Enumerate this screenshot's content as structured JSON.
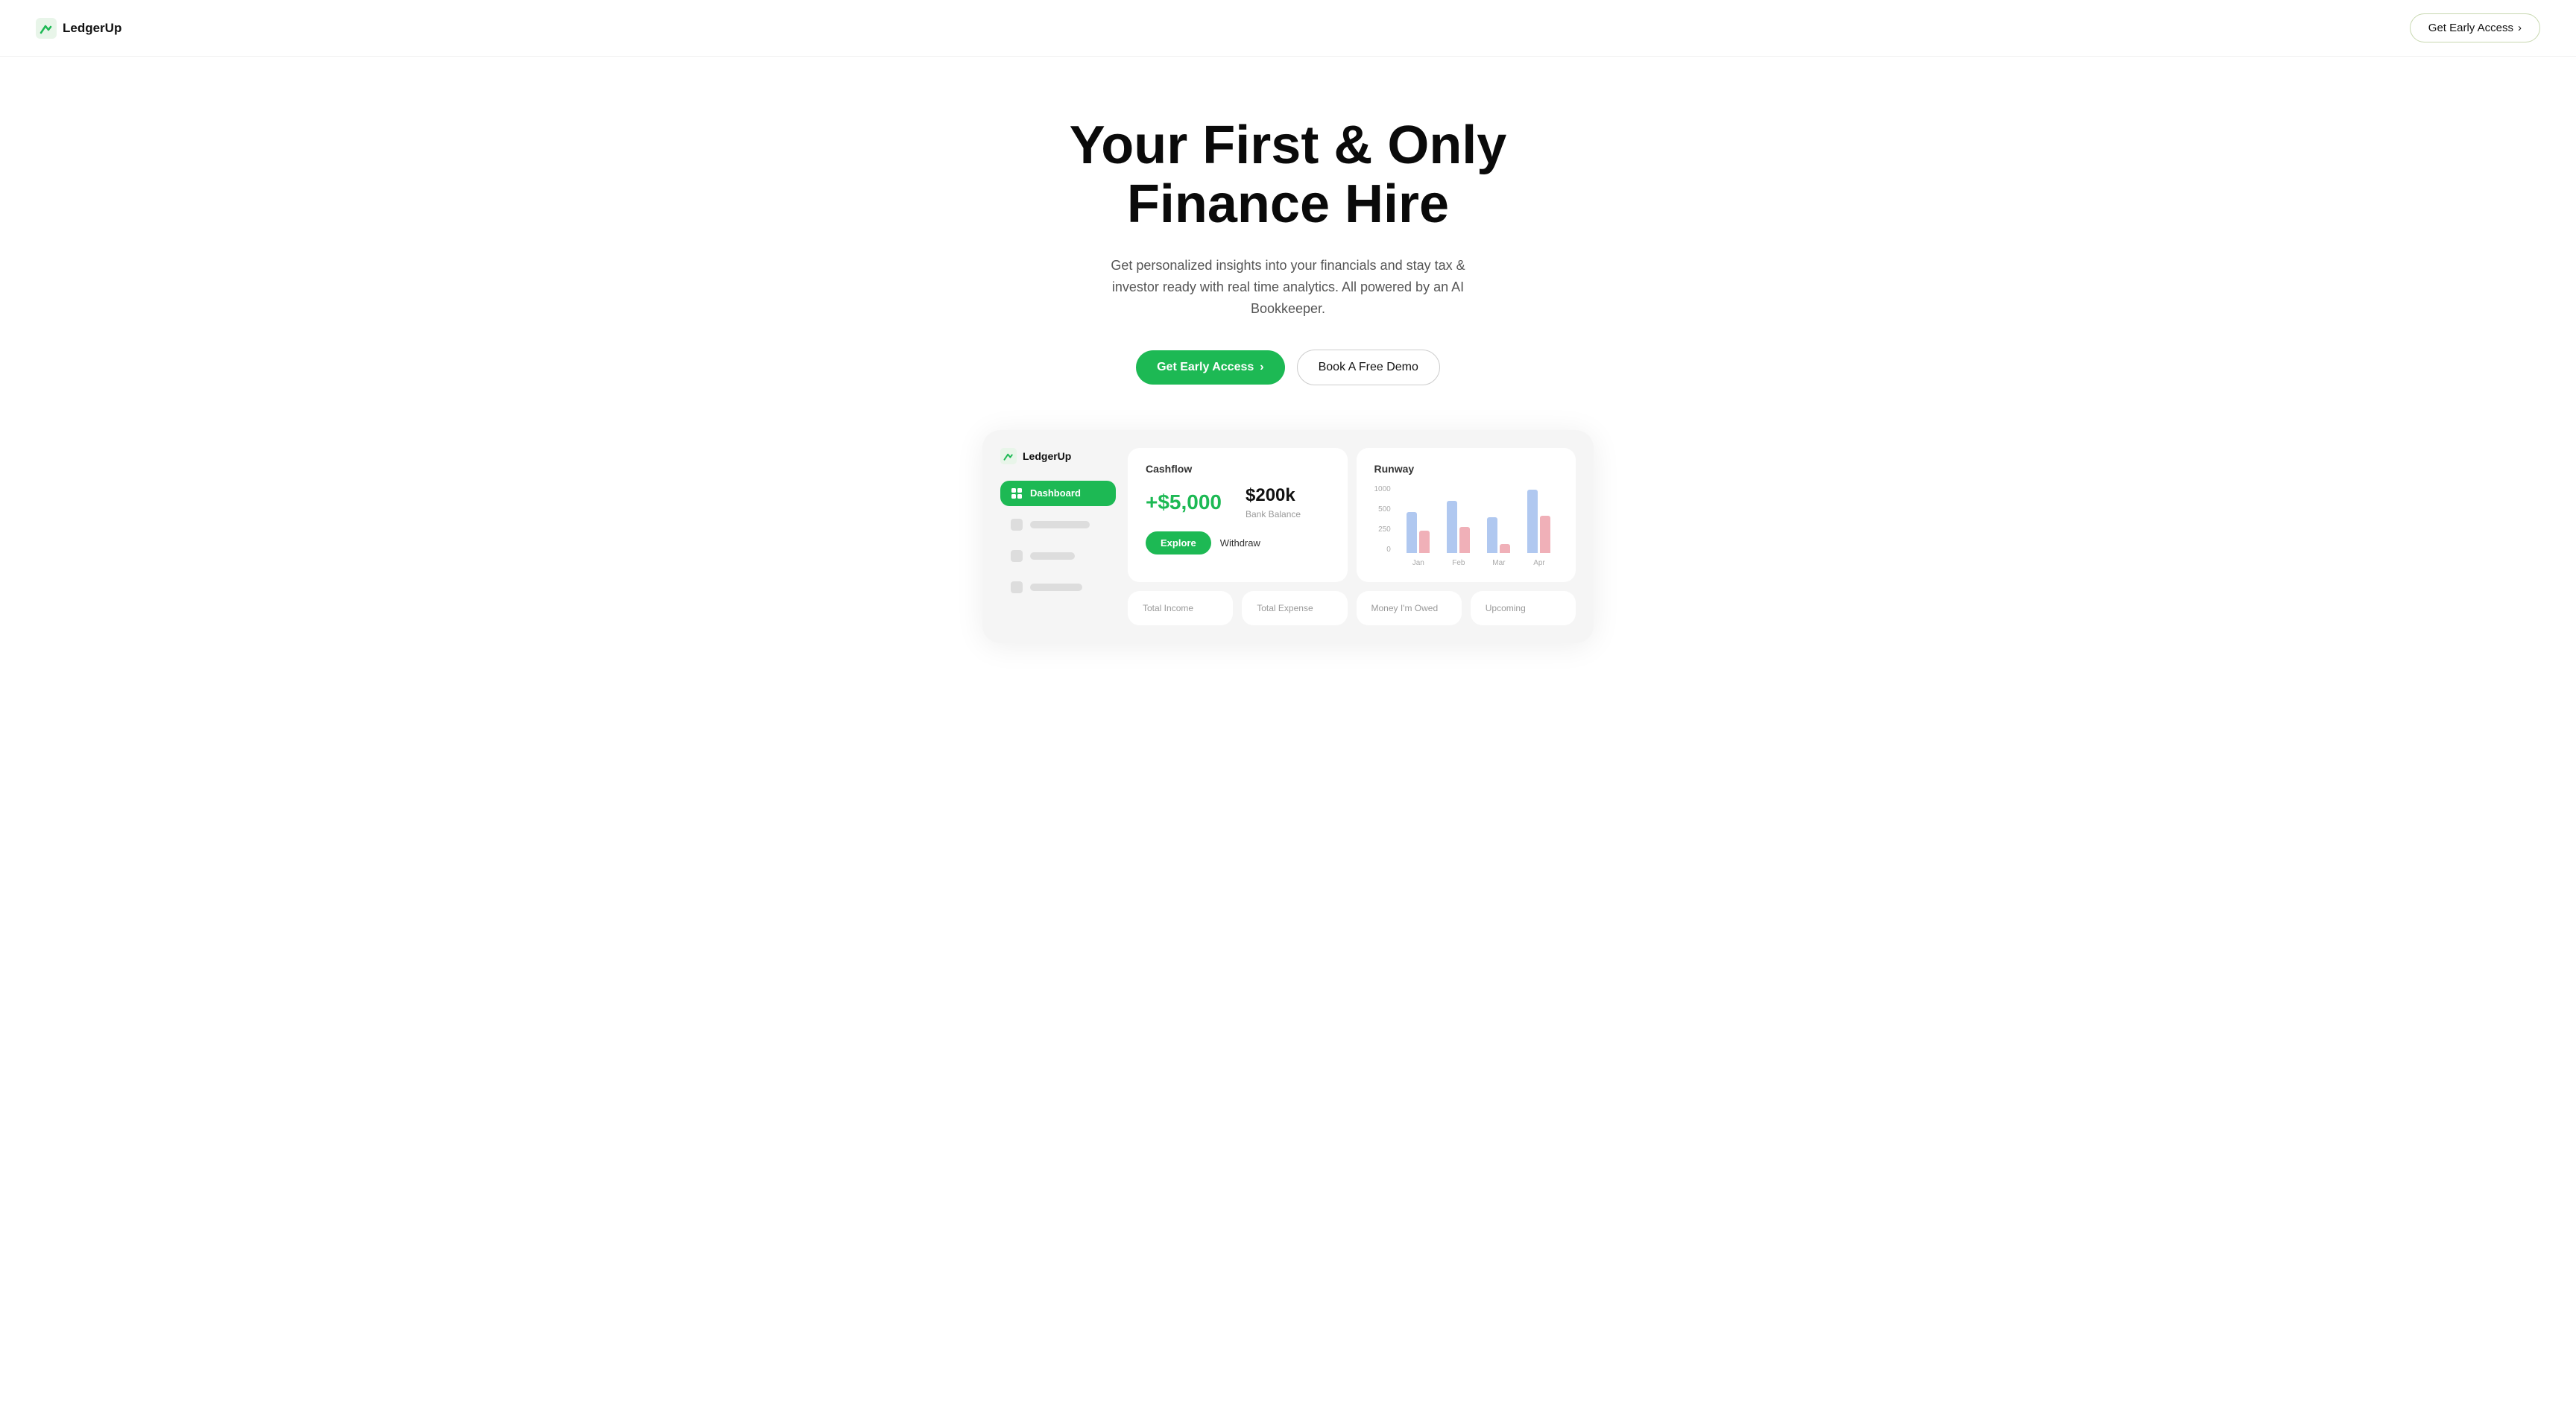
{
  "nav": {
    "logo_text": "LedgerUp",
    "cta_label": "Get Early Access",
    "cta_arrow": "›"
  },
  "hero": {
    "headline_line1": "Your First & Only",
    "headline_line2": "Finance Hire",
    "subtext": "Get personalized insights into your financials and stay tax & investor ready with real time analytics. All powered by an AI Bookkeeper.",
    "btn_primary_label": "Get Early Access",
    "btn_primary_arrow": "›",
    "btn_secondary_label": "Book A Free Demo"
  },
  "preview": {
    "sidebar_logo_text": "LedgerUp",
    "sidebar_active_label": "Dashboard",
    "cashflow_title": "Cashflow",
    "cashflow_amount": "+$5,000",
    "bank_balance_amount": "$200k",
    "bank_balance_label": "Bank Balance",
    "btn_explore": "Explore",
    "btn_withdraw": "Withdraw",
    "runway_title": "Runway",
    "chart_y_labels": [
      "1000",
      "500",
      "250",
      "0"
    ],
    "chart_x_labels": [
      "Jan",
      "Feb",
      "Mar",
      "Apr"
    ],
    "chart_bars": [
      {
        "blue": 55,
        "pink": 30
      },
      {
        "blue": 70,
        "pink": 35
      },
      {
        "blue": 48,
        "pink": 12
      },
      {
        "blue": 85,
        "pink": 50
      }
    ],
    "bottom_cards": [
      {
        "title": "Total Income"
      },
      {
        "title": "Total Expense"
      },
      {
        "title": "Money I'm Owed"
      },
      {
        "title": "Upcoming"
      }
    ]
  }
}
